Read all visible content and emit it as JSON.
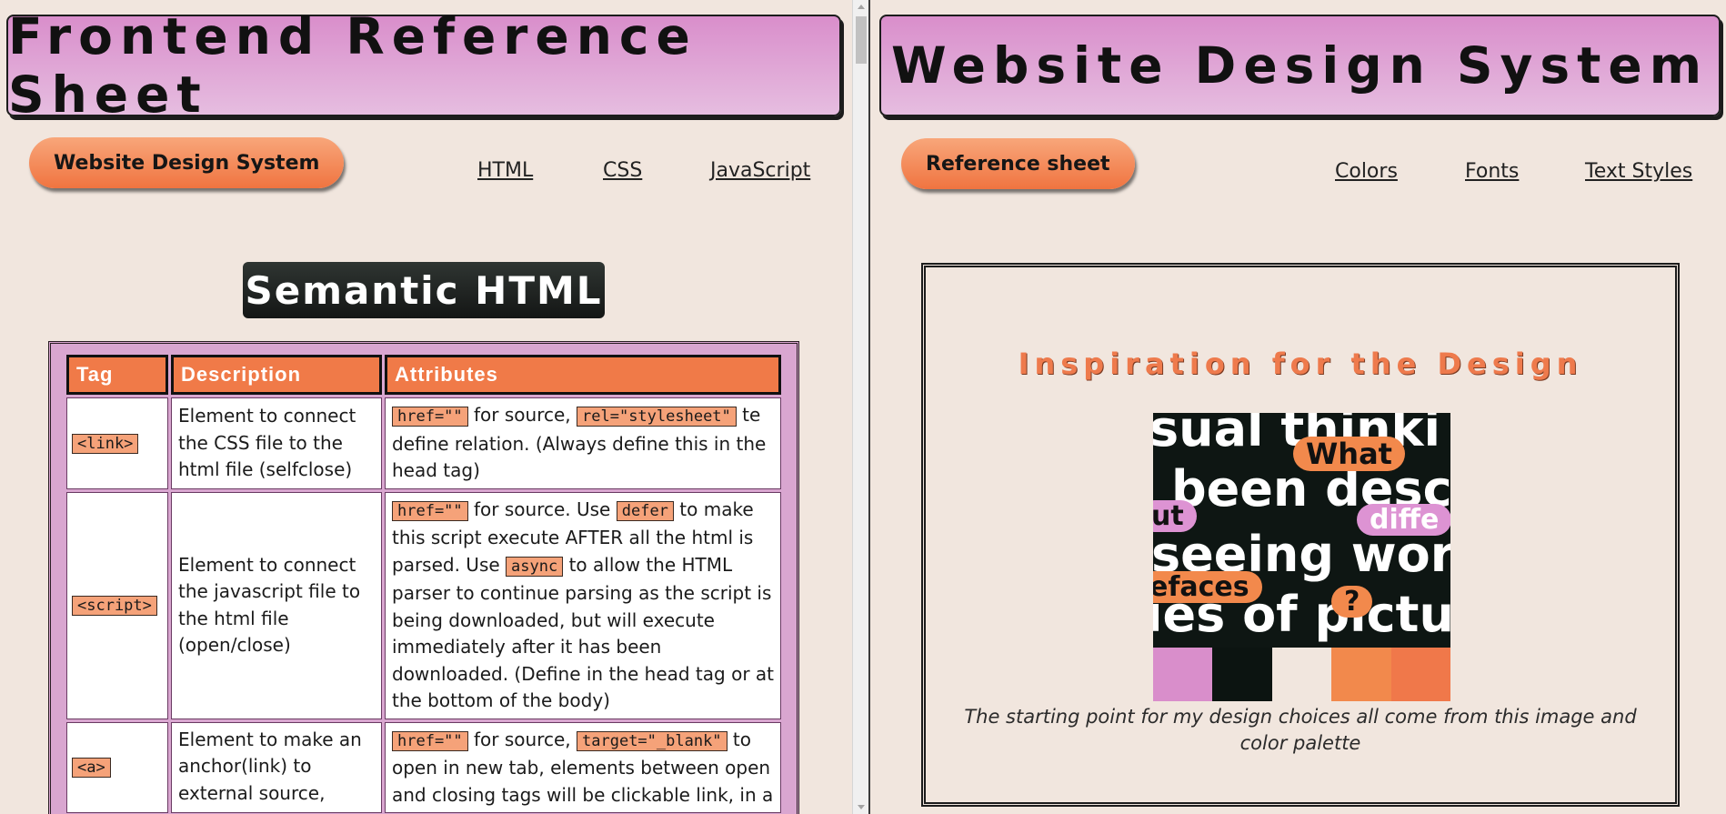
{
  "left": {
    "header_title": "Frontend Reference Sheet",
    "pill_button": "Website Design System",
    "nav": [
      "HTML",
      "CSS",
      "JavaScript"
    ],
    "section_title": "Semantic HTML",
    "table": {
      "headers": [
        "Tag",
        "Description",
        "Attributes"
      ],
      "rows": [
        {
          "tag": "<link>",
          "description": "Element to connect the CSS file to the html file (selfclose)",
          "attr_code_1": "href=\"\"",
          "attr_text_1": " for source, ",
          "attr_code_2": "rel=\"stylesheet\"",
          "attr_text_2": " te define relation. (Always define this in the head tag)"
        },
        {
          "tag": "<script>",
          "description": "Element to connect the javascript file to the html file (open/close)",
          "attr_code_1": "href=\"\"",
          "attr_text_1": " for source. Use ",
          "attr_code_2": "defer",
          "attr_text_2": " to make this script execute AFTER all the html is parsed. Use ",
          "attr_code_3": "async",
          "attr_text_3": " to allow the HTML parser to continue parsing as the script is being downloaded, but will execute immediately after it has been downloaded. (Define in the head tag or at the bottom of the body)"
        },
        {
          "tag": "<a>",
          "description": "Element to make an anchor(link) to external source,",
          "attr_code_1": "href=\"\"",
          "attr_text_1": " for source, ",
          "attr_code_2": "target=\"_blank\"",
          "attr_text_2": " to open in new tab, elements between open and closing tags will be clickable link, in a"
        }
      ]
    }
  },
  "right": {
    "header_title": "Website Design System",
    "pill_button": "Reference sheet",
    "nav": [
      "Colors",
      "Fonts",
      "Text Styles"
    ],
    "inspiration": {
      "title": "Inspiration for the Design",
      "image_words": [
        "sual thinki",
        "been descr",
        "seeing word",
        "ies of pictu"
      ],
      "image_tags": [
        "What",
        "ut",
        "diffe",
        "efaces",
        "?"
      ],
      "palette": [
        "#d98ecb",
        "#0c1411",
        "#f1e6de",
        "#f2894c",
        "#f0784a"
      ],
      "caption": "The starting point for my design choices all come from this image and color palette"
    }
  },
  "colors": {
    "background": "#f1e6de",
    "header_gradient_top": "#d98ecb",
    "accent_orange": "#f07a48",
    "dark": "#141615"
  }
}
